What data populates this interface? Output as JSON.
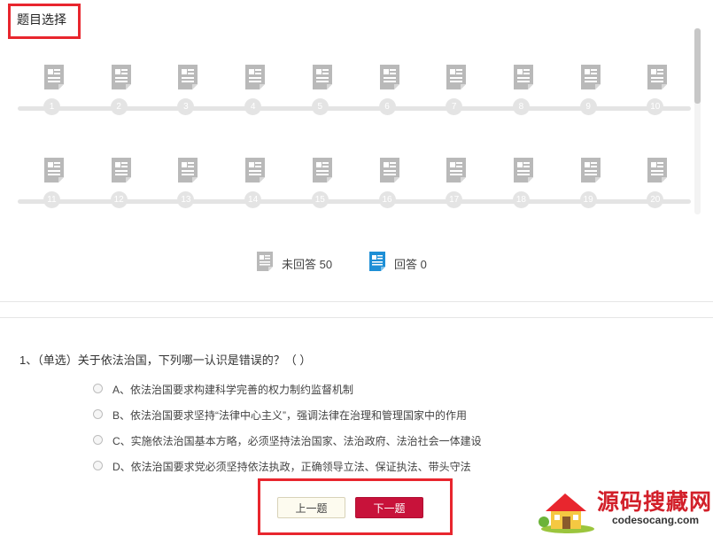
{
  "panel": {
    "title": "题目选择"
  },
  "question_grid": {
    "row1": [
      "1",
      "2",
      "3",
      "4",
      "5",
      "6",
      "7",
      "8",
      "9",
      "10"
    ],
    "row2": [
      "11",
      "12",
      "13",
      "14",
      "15",
      "16",
      "17",
      "18",
      "19",
      "20"
    ]
  },
  "legend": {
    "unanswered_label": "未回答 50",
    "answered_label": "回答 0"
  },
  "question": {
    "text": "1、（单选）关于依法治国，下列哪一认识是错误的？（ ）",
    "options": [
      "A、依法治国要求构建科学完善的权力制约监督机制",
      "B、依法治国要求坚持“法律中心主义”，强调法律在治理和管理国家中的作用",
      "C、实施依法治国基本方略，必须坚持法治国家、法治政府、法治社会一体建设",
      "D、依法治国要求党必须坚持依法执政，正确领导立法、保证执法、带头守法"
    ]
  },
  "buttons": {
    "prev": "上一题",
    "next": "下一题"
  },
  "watermark": {
    "cn": "源码搜藏网",
    "en": "codesocang.com"
  },
  "colors": {
    "accent": "#e8262e",
    "next_button": "#c8123a",
    "icon_gray": "#b9b9b9",
    "icon_blue": "#1e8fd6"
  }
}
